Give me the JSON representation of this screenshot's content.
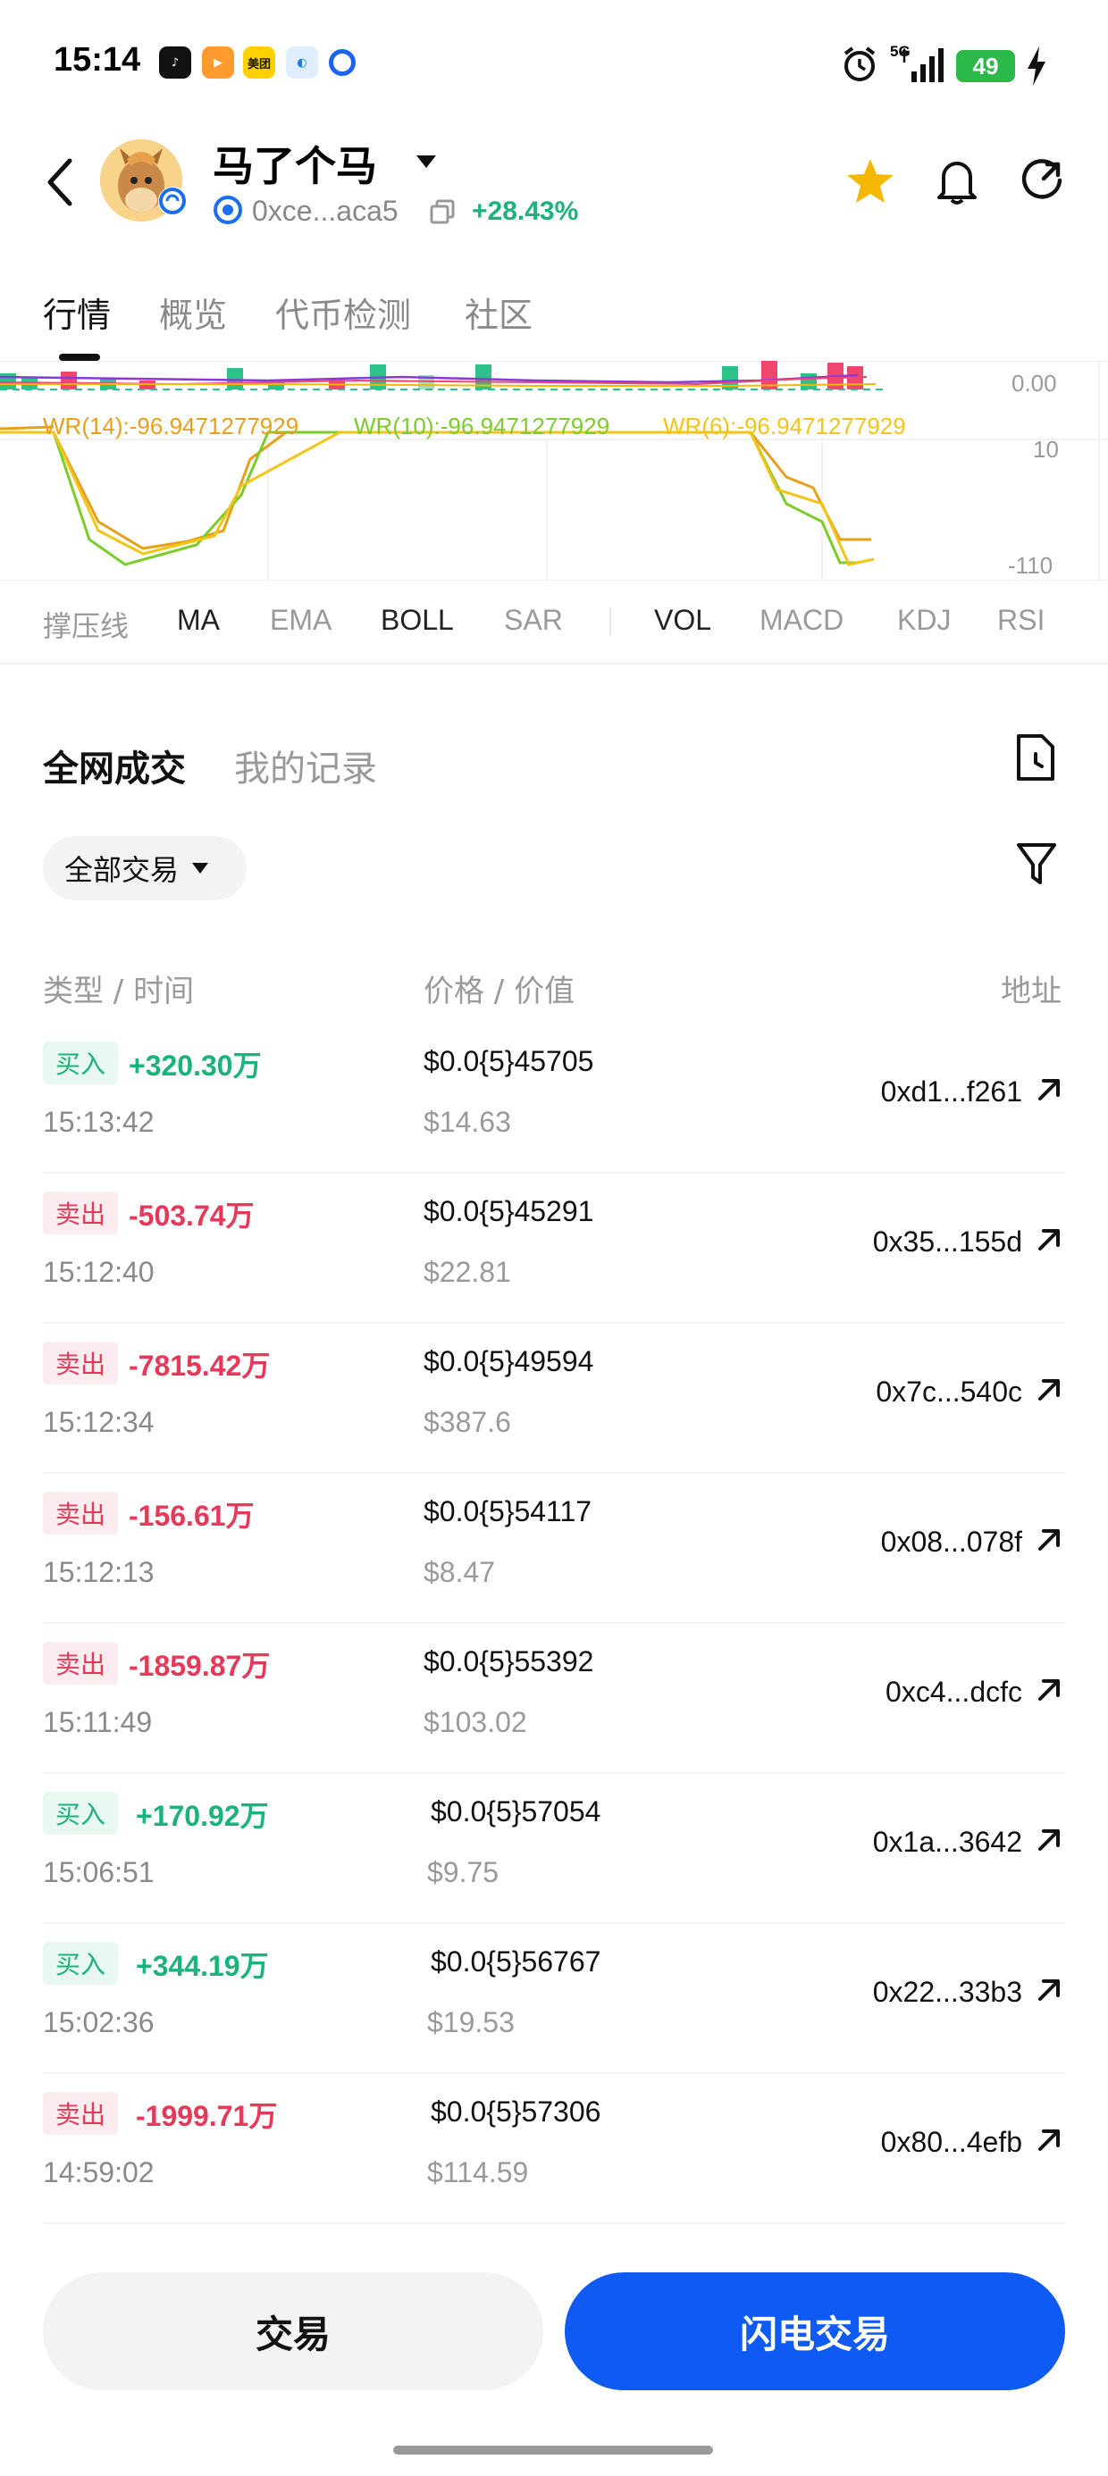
{
  "status_bar": {
    "time": "15:14",
    "app_icons": [
      "tiktok-icon",
      "video-app-icon",
      "meituan-icon",
      "cloud-app-icon",
      "blue-dot-app-icon"
    ],
    "meituan_label": "美团",
    "network": "5G",
    "battery": "49"
  },
  "header": {
    "token_name": "马了个马",
    "address": "0xce...aca5",
    "change": "+28.43%"
  },
  "tabs": [
    {
      "label": "行情"
    },
    {
      "label": "概览"
    },
    {
      "label": "代币检测"
    },
    {
      "label": "社区"
    }
  ],
  "chart": {
    "volume_axis_label": "0.00",
    "wr_legend": [
      {
        "label": "WR(14):-96.9471277929",
        "color": "#e8a01a"
      },
      {
        "label": "WR(10):-96.9471277929",
        "color": "#7ccc2a"
      },
      {
        "label": "WR(6):-96.9471277929",
        "color": "#f2c518"
      }
    ],
    "wr_axis_top": "10",
    "wr_axis_bottom": "-110"
  },
  "indicators": {
    "main": [
      "撑压线",
      "MA",
      "EMA",
      "BOLL",
      "SAR"
    ],
    "sub": [
      "VOL",
      "MACD",
      "KDJ",
      "RSI"
    ]
  },
  "trades_section": {
    "tab_all": "全网成交",
    "tab_mine": "我的记录",
    "filter_label": "全部交易",
    "col_type_time": "类型 / 时间",
    "col_price_value": "价格 / 价值",
    "col_address": "地址"
  },
  "trades": [
    {
      "type": "买入",
      "side": "buy",
      "amount": "+320.30万",
      "time": "15:13:42",
      "price": "$0.0{5}45705",
      "value": "$14.63",
      "address": "0xd1...f261"
    },
    {
      "type": "卖出",
      "side": "sell",
      "amount": "-503.74万",
      "time": "15:12:40",
      "price": "$0.0{5}45291",
      "value": "$22.81",
      "address": "0x35...155d"
    },
    {
      "type": "卖出",
      "side": "sell",
      "amount": "-7815.42万",
      "time": "15:12:34",
      "price": "$0.0{5}49594",
      "value": "$387.6",
      "address": "0x7c...540c"
    },
    {
      "type": "卖出",
      "side": "sell",
      "amount": "-156.61万",
      "time": "15:12:13",
      "price": "$0.0{5}54117",
      "value": "$8.47",
      "address": "0x08...078f"
    },
    {
      "type": "卖出",
      "side": "sell",
      "amount": "-1859.87万",
      "time": "15:11:49",
      "price": "$0.0{5}55392",
      "value": "$103.02",
      "address": "0xc4...dcfc"
    },
    {
      "type": "买入",
      "side": "buy",
      "amount": "+170.92万",
      "time": "15:06:51",
      "price": "$0.0{5}57054",
      "value": "$9.75",
      "address": "0x1a...3642"
    },
    {
      "type": "买入",
      "side": "buy",
      "amount": "+344.19万",
      "time": "15:02:36",
      "price": "$0.0{5}56767",
      "value": "$19.53",
      "address": "0x22...33b3"
    },
    {
      "type": "卖出",
      "side": "sell",
      "amount": "-1999.71万",
      "time": "14:59:02",
      "price": "$0.0{5}57306",
      "value": "$114.59",
      "address": "0x80...4efb"
    }
  ],
  "buttons": {
    "trade": "交易",
    "flash_trade": "闪电交易"
  },
  "colors": {
    "buy": "#1bb37a",
    "sell": "#e5395a",
    "primary": "#0e5af2",
    "star": "#f5b800"
  }
}
